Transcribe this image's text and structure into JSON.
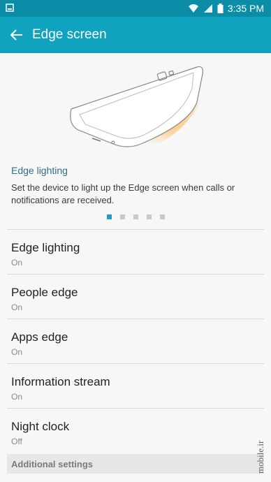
{
  "status_bar": {
    "time": "3:35 PM",
    "icons": [
      "notification-icon",
      "wifi-icon",
      "signal-icon",
      "battery-icon"
    ]
  },
  "app_bar": {
    "title": "Edge screen",
    "back_icon": "arrow-left-icon"
  },
  "hero": {
    "title": "Edge lighting",
    "description": "Set the device to light up the Edge screen when calls or notifications are received.",
    "pager": {
      "count": 5,
      "active_index": 0
    }
  },
  "settings": [
    {
      "label": "Edge lighting",
      "value": "On"
    },
    {
      "label": "People edge",
      "value": "On"
    },
    {
      "label": "Apps edge",
      "value": "On"
    },
    {
      "label": "Information stream",
      "value": "On"
    },
    {
      "label": "Night clock",
      "value": "Off"
    }
  ],
  "section_header": "Additional settings",
  "watermark": "mobile.ir",
  "colors": {
    "statusbar": "#0b8da7",
    "appbar": "#0fa3bf",
    "accent_dot": "#1d9ec2",
    "glow": "#ffb24a"
  }
}
